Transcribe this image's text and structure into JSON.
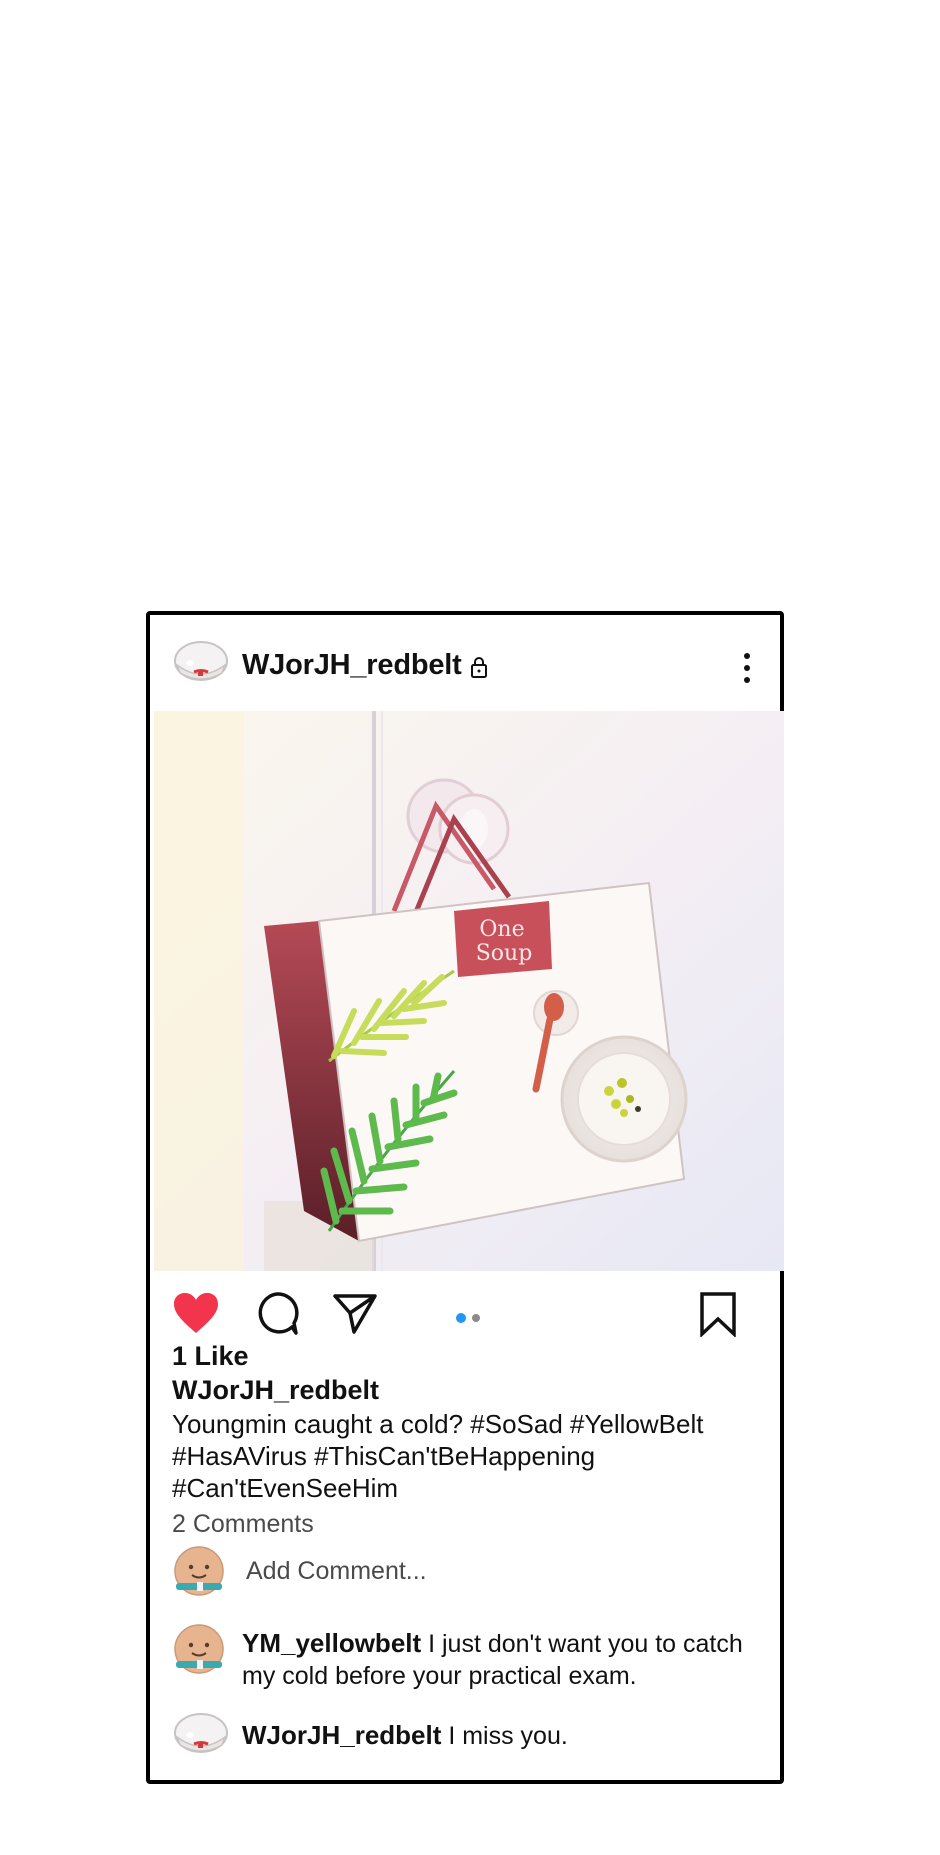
{
  "post": {
    "username": "WJorJH_redbelt",
    "image": {
      "bag_logo_line1": "One",
      "bag_logo_line2": "Soup"
    },
    "likes": "1 Like",
    "caption_user": "WJorJH_redbelt",
    "caption_lines": [
      "Youngmin caught a cold? #SoSad #YellowBelt",
      "#HasAVirus #ThisCan'tBeHappening",
      "#Can'tEvenSeeHim"
    ],
    "comments_count": "2 Comments",
    "add_comment_placeholder": "Add Comment...",
    "comments": [
      {
        "user": "YM_yellowbelt",
        "text": "I just don't want you to catch my cold before your practical exam."
      },
      {
        "user": "WJorJH_redbelt",
        "text": "I miss you."
      }
    ],
    "carousel": {
      "count": 2,
      "active": 1
    }
  },
  "colors": {
    "heart": "#f2354d",
    "carousel_active": "#2196f3",
    "bag_red": "#c8505a",
    "avatar_tan": "#e6b48f",
    "avatar_teal": "#3aa9b0"
  },
  "icons": [
    "white-avatar-icon",
    "lock-icon",
    "more-options-icon",
    "heart-icon",
    "comment-icon",
    "share-icon",
    "bookmark-icon",
    "tan-avatar-icon"
  ]
}
